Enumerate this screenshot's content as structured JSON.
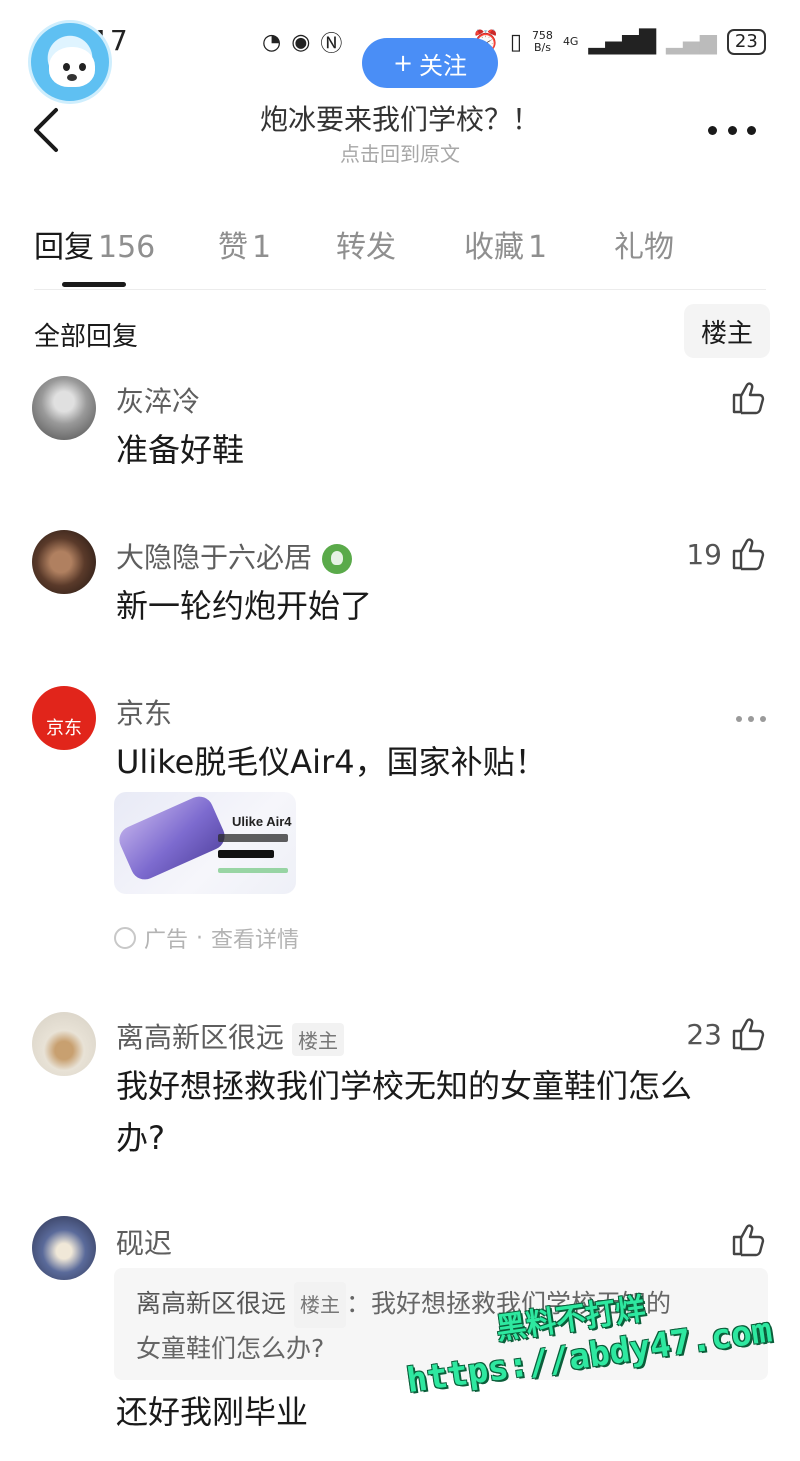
{
  "status_bar": {
    "time": "17",
    "speed_value": "758",
    "speed_unit": "B/s",
    "network": "4G",
    "battery": "23"
  },
  "header": {
    "follow_label": "关注",
    "title": "炮冰要来我们学校？！",
    "subtitle": "点击回到原文"
  },
  "tabs": [
    {
      "label": "回复",
      "count": "156",
      "active": true
    },
    {
      "label": "赞",
      "count": "1"
    },
    {
      "label": "转发",
      "count": ""
    },
    {
      "label": "收藏",
      "count": "1"
    },
    {
      "label": "礼物",
      "count": ""
    }
  ],
  "filter": {
    "all_label": "全部回复",
    "op_label": "楼主"
  },
  "comments": [
    {
      "username": "灰淬冷",
      "text": "准备好鞋",
      "likes": ""
    },
    {
      "username": "大隐隐于六必居",
      "text": "新一轮约炮开始了",
      "likes": "19"
    },
    {
      "username": "离高新区很远",
      "badge": "楼主",
      "text_line1": "我好想拯救我们学校无知的女童鞋们怎么",
      "text_line2": "办?",
      "likes": "23"
    },
    {
      "username": "砚迟",
      "quote_user": "离高新区很远",
      "quote_badge": "楼主",
      "quote_line1": "：我好想拯救我们学校无知的",
      "quote_line2": "女童鞋们怎么办?",
      "text": "还好我刚毕业",
      "likes": ""
    }
  ],
  "ad": {
    "username": "京东",
    "avatar_text": "京东",
    "text": "Ulike脱毛仪Air4，国家补贴！",
    "image_brand": "Ulike Air4",
    "footer_label": "广告",
    "footer_separator": "·",
    "footer_details": "查看详情"
  },
  "watermark": {
    "line1": "黑料不打烊",
    "line2": "https://abdy47.com"
  },
  "colors": {
    "follow_button": "#4a8ef6",
    "jd_red": "#e1251b",
    "watermark": "#2ee8a0"
  }
}
